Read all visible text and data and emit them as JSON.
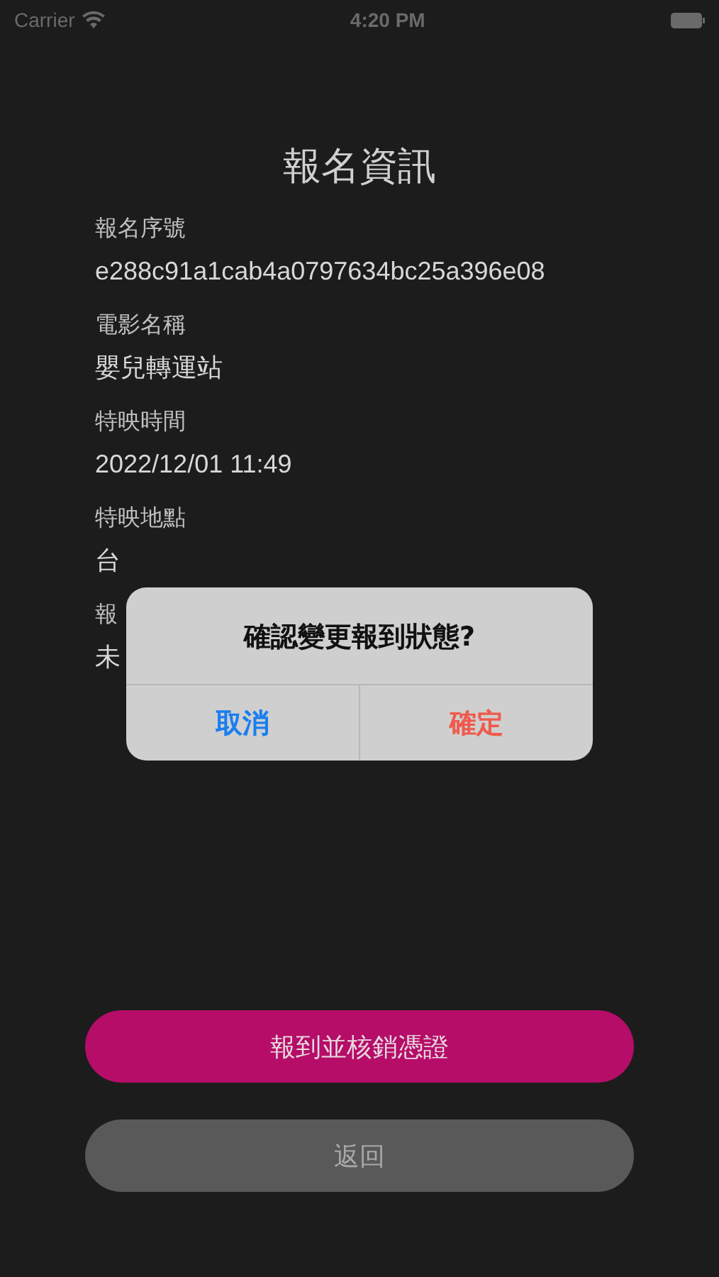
{
  "status_bar": {
    "carrier": "Carrier",
    "time": "4:20 PM"
  },
  "title": "報名資訊",
  "fields": [
    {
      "label": "報名序號",
      "value": "e288c91a1cab4a0797634bc25a396e08"
    },
    {
      "label": "電影名稱",
      "value": "嬰兒轉運站"
    },
    {
      "label": "特映時間",
      "value": "2022/12/01 11:49"
    },
    {
      "label": "特映地點",
      "value": "台"
    },
    {
      "label": "報",
      "value": "未"
    }
  ],
  "buttons": [
    {
      "label": "報到並核銷憑證",
      "kind": "primary"
    },
    {
      "label": "返回",
      "kind": "secondary"
    }
  ],
  "alert": {
    "title": "確認變更報到狀態?",
    "actions": [
      {
        "label": "取消",
        "kind": "cancel"
      },
      {
        "label": "確定",
        "kind": "destructive"
      }
    ]
  }
}
